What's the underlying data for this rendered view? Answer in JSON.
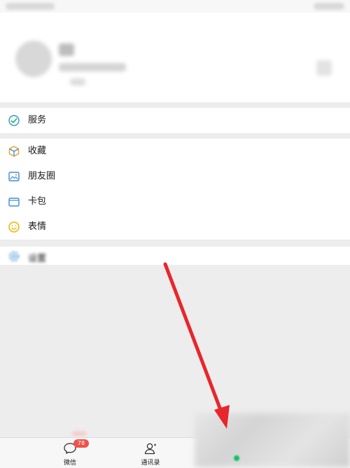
{
  "menu": {
    "service": {
      "label": "服务",
      "icon": "service-check-icon"
    },
    "items": [
      {
        "label": "收藏",
        "icon": "favorites-cube-icon"
      },
      {
        "label": "朋友圈",
        "icon": "moments-photo-icon"
      },
      {
        "label": "卡包",
        "icon": "card-wallet-icon"
      },
      {
        "label": "表情",
        "icon": "emoji-smile-icon"
      }
    ],
    "settings": {
      "label": "设置",
      "icon": "settings-gear-icon"
    }
  },
  "tabbar": {
    "tabs": [
      {
        "label": "微信",
        "icon": "chat-bubble-icon",
        "badge": "78"
      },
      {
        "label": "通讯录",
        "icon": "contacts-icon"
      }
    ]
  },
  "colors": {
    "accent_green": "#07c160",
    "badge_red": "#f0524a",
    "annotation_red": "#e8262b"
  },
  "annotation": {
    "type": "red-arrow",
    "points_to": "bottom-right tab"
  }
}
